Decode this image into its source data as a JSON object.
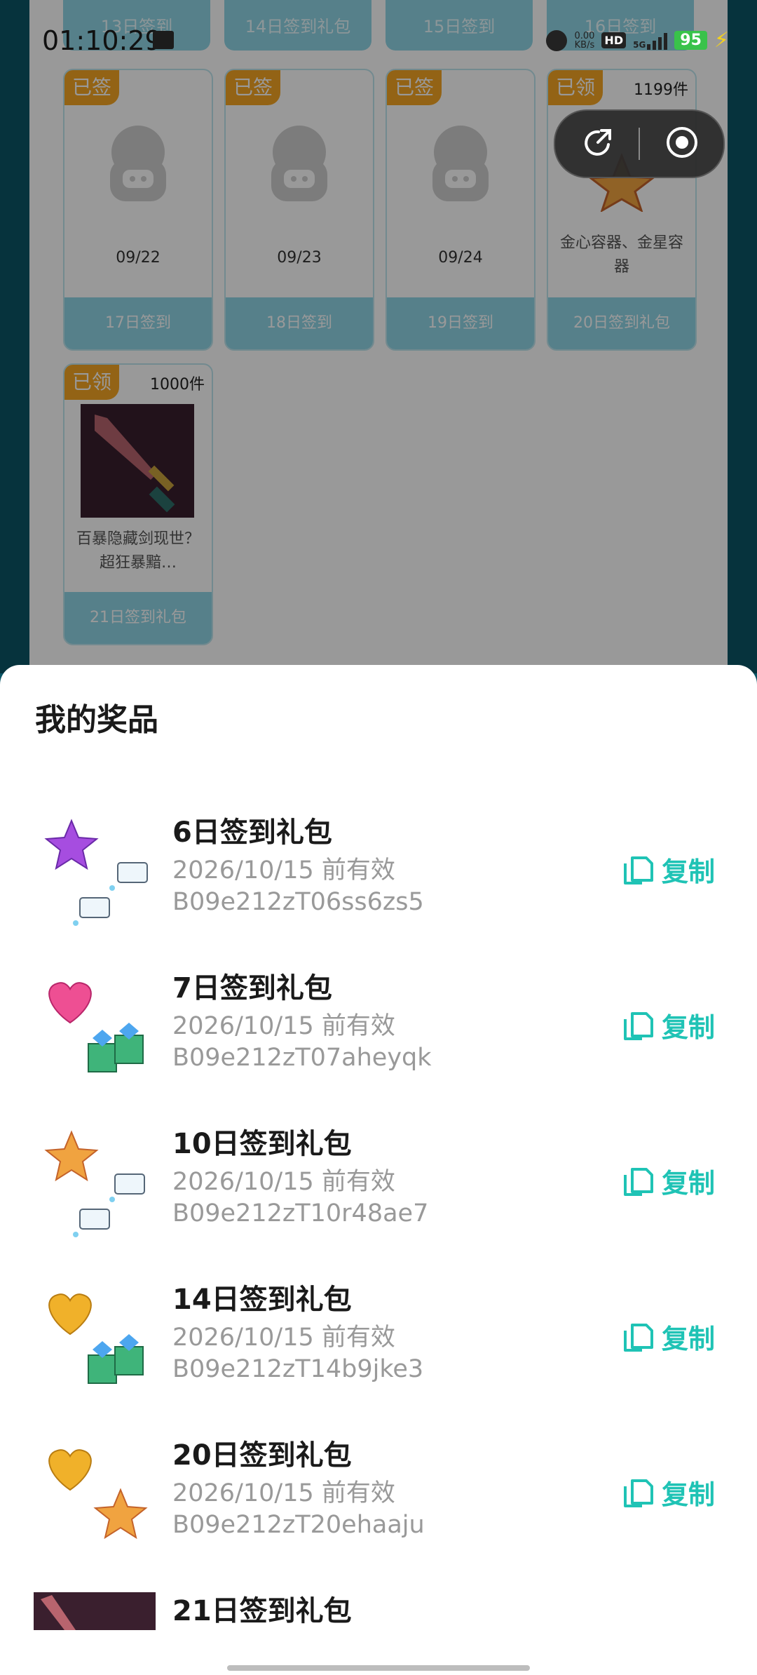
{
  "status_bar": {
    "time": "01:10:29",
    "net_speed": "0.00\nKB/s",
    "hd": "HD",
    "signal": "5G",
    "battery": "95"
  },
  "top_row": [
    "13日签到",
    "14日签到礼包",
    "15日签到",
    "16日签到"
  ],
  "cards": [
    {
      "badge": "已签",
      "date": "09/22",
      "footer": "17日签到"
    },
    {
      "badge": "已签",
      "date": "09/23",
      "footer": "18日签到"
    },
    {
      "badge": "已签",
      "date": "09/24",
      "footer": "19日签到"
    },
    {
      "badge": "已领",
      "count": "1199件",
      "desc": "金心容器、金星容器",
      "footer": "20日签到礼包"
    },
    {
      "badge": "已领",
      "count": "1000件",
      "desc": "百暴隐藏剑现世？超狂暴黯…",
      "footer": "21日签到礼包"
    }
  ],
  "sheet": {
    "title": "我的奖品",
    "copy_label": "复制",
    "prizes": [
      {
        "name": "6日签到礼包",
        "expiry": "2026/10/15 前有效",
        "code": "B09e212zT06ss6zs5",
        "icon": "purple-star-tickets"
      },
      {
        "name": "7日签到礼包",
        "expiry": "2026/10/15 前有效",
        "code": "B09e212zT07aheyqk",
        "icon": "pink-heart-gems"
      },
      {
        "name": "10日签到礼包",
        "expiry": "2026/10/15 前有效",
        "code": "B09e212zT10r48ae7",
        "icon": "gold-star-tickets"
      },
      {
        "name": "14日签到礼包",
        "expiry": "2026/10/15 前有效",
        "code": "B09e212zT14b9jke3",
        "icon": "gold-heart-gems"
      },
      {
        "name": "20日签到礼包",
        "expiry": "2026/10/15 前有效",
        "code": "B09e212zT20ehaaju",
        "icon": "gold-heart-star"
      },
      {
        "name": "21日签到礼包",
        "icon": "sword"
      }
    ]
  },
  "colors": {
    "accent": "#1fc3b5",
    "badge": "#f5a623",
    "card_footer": "#8fd5e6",
    "backdrop": "#0a5566"
  }
}
